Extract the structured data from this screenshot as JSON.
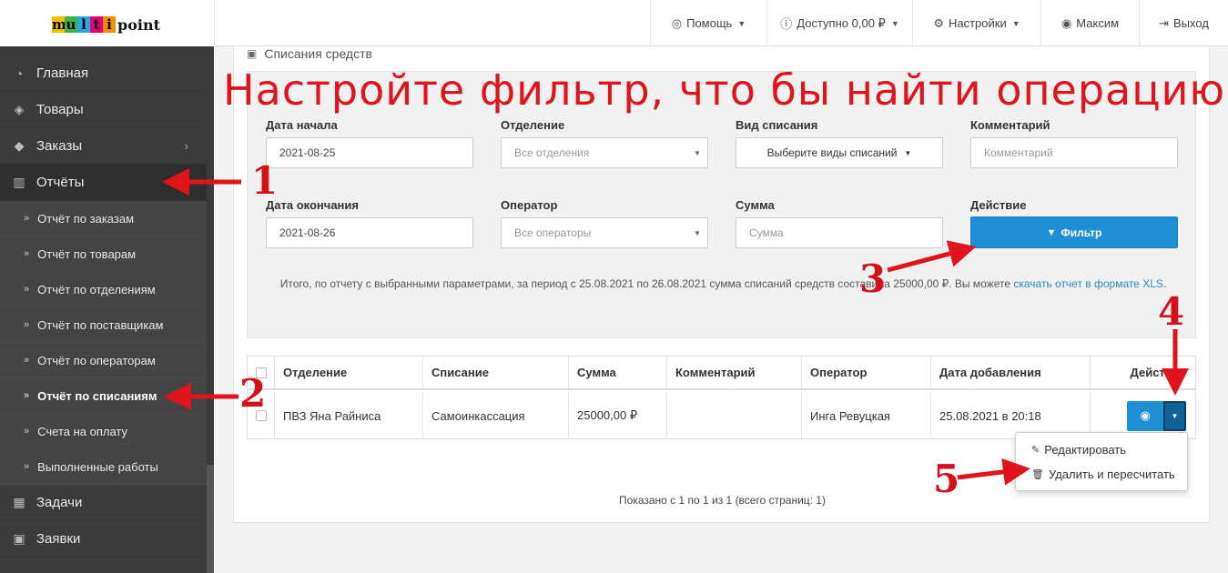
{
  "logo": {
    "letters": [
      "m",
      "u",
      "l",
      "t",
      "i"
    ],
    "letter_colors": [
      "#f2c200",
      "#3cb44b",
      "#29a7e0",
      "#e6007e",
      "#f29100"
    ],
    "tail": "point"
  },
  "topnav": [
    {
      "icon": "lifebuoy-icon",
      "label": "Помощь",
      "caret": true
    },
    {
      "icon": "info-icon",
      "label": "Доступно 0,00 ₽",
      "caret": true
    },
    {
      "icon": "gear-icon",
      "label": "Настройки",
      "caret": true
    },
    {
      "icon": "user-icon",
      "label": "Максим",
      "caret": false
    },
    {
      "icon": "logout-icon",
      "label": "Выход",
      "caret": false
    }
  ],
  "sidebar": {
    "items": [
      {
        "icon": "dashboard-icon",
        "label": "Главная"
      },
      {
        "icon": "tags-icon",
        "label": "Товары"
      },
      {
        "icon": "cube-icon",
        "label": "Заказы"
      },
      {
        "icon": "bar-chart-icon",
        "label": "Отчёты"
      }
    ],
    "subitems": [
      "Отчёт по заказам",
      "Отчёт по товарам",
      "Отчёт по отделениям",
      "Отчёт по поставщикам",
      "Отчёт по операторам",
      "Отчёт по списаниям",
      "Счета на оплату",
      "Выполненные работы"
    ],
    "bottom_items": [
      {
        "icon": "calendar-icon",
        "label": "Задачи"
      },
      {
        "icon": "box-icon",
        "label": "Заявки"
      }
    ]
  },
  "page": {
    "title": "Списания средств"
  },
  "annotation": {
    "headline": "Настройте фильтр, что бы найти операцию",
    "numbers": [
      "1",
      "2",
      "3",
      "4",
      "5"
    ]
  },
  "filter": {
    "date_start": {
      "label": "Дата начала",
      "value": "2021-08-25"
    },
    "department": {
      "label": "Отделение",
      "value": "Все отделения"
    },
    "writeoff_type": {
      "label": "Вид списания",
      "value": "Выберите виды списаний"
    },
    "comment": {
      "label": "Комментарий",
      "placeholder": "Комментарий"
    },
    "date_end": {
      "label": "Дата окончания",
      "value": "2021-08-26"
    },
    "operator": {
      "label": "Оператор",
      "value": "Все операторы"
    },
    "amount": {
      "label": "Сумма",
      "placeholder": "Сумма"
    },
    "action": {
      "label": "Действие",
      "button": "Фильтр"
    }
  },
  "summary": {
    "text": "Итого, по отчету с выбранными параметрами, за период с 25.08.2021 по 26.08.2021 сумма списаний средств составила 25000,00 ₽. Вы можете ",
    "link": "скачать отчет в формате XLS",
    "end": "."
  },
  "table": {
    "columns": [
      "Отделение",
      "Списание",
      "Сумма",
      "Комментарий",
      "Оператор",
      "Дата добавления",
      "Действие"
    ],
    "rows": [
      {
        "department": "ПВЗ Яна Райниса",
        "writeoff": "Самоинкассация",
        "amount": "25000,00 ₽",
        "comment": "",
        "operator": "Инга Ревуцкая",
        "date": "25.08.2021 в 20:18"
      }
    ]
  },
  "dropdown": {
    "edit": "Редактировать",
    "delete": "Удалить и пересчитать"
  },
  "pagination": {
    "info": "Показано с 1 по 1 из 1 (всего страниц: 1)"
  },
  "colors": {
    "accent": "#1e8fd4",
    "annotation_red": "#e0141c",
    "sidebar": "#3b3b3b"
  }
}
